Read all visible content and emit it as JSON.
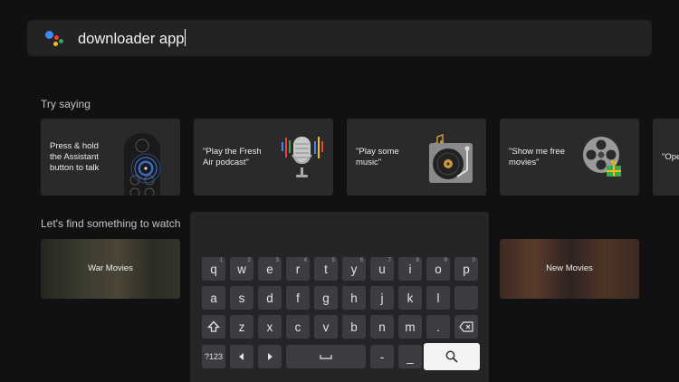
{
  "search": {
    "query": "downloader app"
  },
  "colors": {
    "google_blue": "#4285F4",
    "google_red": "#EA4335",
    "google_yellow": "#FBBC05",
    "google_green": "#34A853"
  },
  "try_saying": {
    "title": "Try saying",
    "cards": [
      {
        "text_lines": [
          "Press & hold",
          "the Assistant",
          "button to talk"
        ],
        "icon": "remote-icon"
      },
      {
        "text_lines": [
          "\"Play the Fresh",
          "Air podcast\""
        ],
        "icon": "microphone-icon"
      },
      {
        "text_lines": [
          "\"Play some",
          "music\""
        ],
        "icon": "turntable-icon"
      },
      {
        "text_lines": [
          "\"Show me free",
          "movies\""
        ],
        "icon": "film-reel-icon"
      },
      {
        "text_lines": [
          "\"Ope"
        ],
        "icon": ""
      }
    ]
  },
  "watch": {
    "title": "Let's find something to watch",
    "cards": [
      {
        "label": "War Movies"
      },
      {
        "label": "New Movies"
      }
    ]
  },
  "keyboard": {
    "row1": [
      {
        "k": "q",
        "n": "1"
      },
      {
        "k": "w",
        "n": "2"
      },
      {
        "k": "e",
        "n": "3"
      },
      {
        "k": "r",
        "n": "4"
      },
      {
        "k": "t",
        "n": "5"
      },
      {
        "k": "y",
        "n": "6"
      },
      {
        "k": "u",
        "n": "7"
      },
      {
        "k": "i",
        "n": "8"
      },
      {
        "k": "o",
        "n": "9"
      },
      {
        "k": "p",
        "n": "0"
      }
    ],
    "row2": [
      "a",
      "s",
      "d",
      "f",
      "g",
      "h",
      "j",
      "k",
      "l"
    ],
    "row3": [
      "z",
      "x",
      "c",
      "v",
      "b",
      "n",
      "m",
      "."
    ],
    "symbols_label": "?123",
    "dash_label": "-",
    "underscore_label": "_"
  }
}
